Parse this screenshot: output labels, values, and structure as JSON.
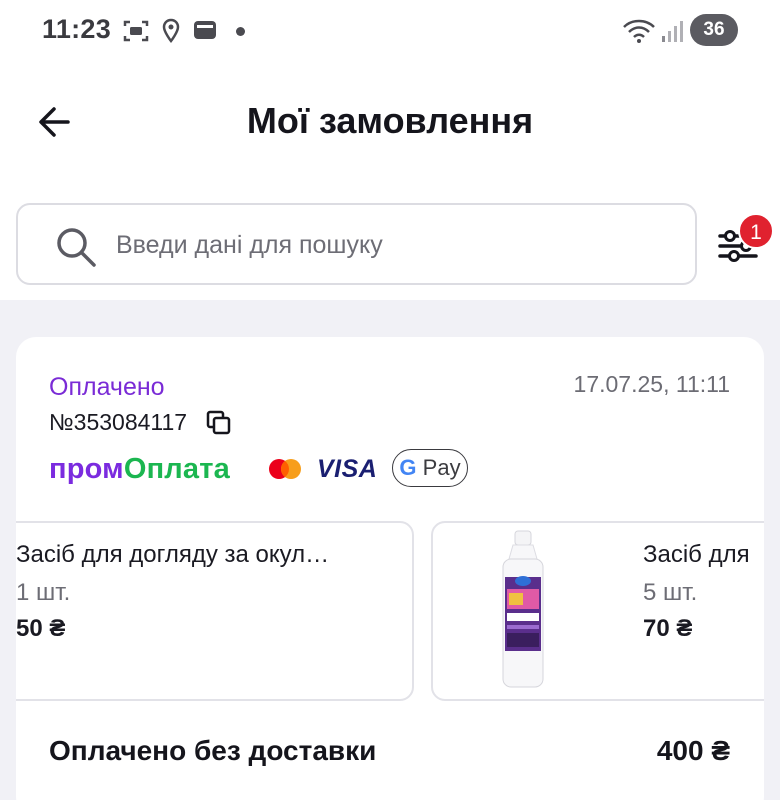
{
  "status_bar": {
    "time": "11:23",
    "battery": "36",
    "icons": [
      "screenshot-icon",
      "location-icon",
      "wallet-icon",
      "wifi-icon",
      "signal-icon"
    ]
  },
  "header": {
    "title": "Мої замовлення",
    "back_icon": "arrow-left-icon"
  },
  "search": {
    "placeholder": "Введи дані для пошуку",
    "value": ""
  },
  "filter": {
    "icon": "filter-sliders-icon",
    "badge_count": "1"
  },
  "order": {
    "status": "Оплачено",
    "date": "17.07.25, 11:11",
    "number": "№353084117",
    "payment": {
      "prom_part1": "пром",
      "prom_part2": "Оплата",
      "visa": "VISA",
      "gpay_g": "G",
      "gpay_text": " Pay"
    },
    "items": [
      {
        "name": "Засіб для догляду за окул…",
        "qty": "1 шт.",
        "price": "50 ₴"
      },
      {
        "name": "Засіб для",
        "qty": "5 шт.",
        "price": "70 ₴"
      }
    ],
    "summary_label": "Оплачено без доставки",
    "total": "400 ₴"
  },
  "colors": {
    "accent_purple": "#7b2bdf",
    "prom_green": "#1bb650",
    "badge_red": "#e0222f",
    "list_background": "#f1f1f6"
  }
}
